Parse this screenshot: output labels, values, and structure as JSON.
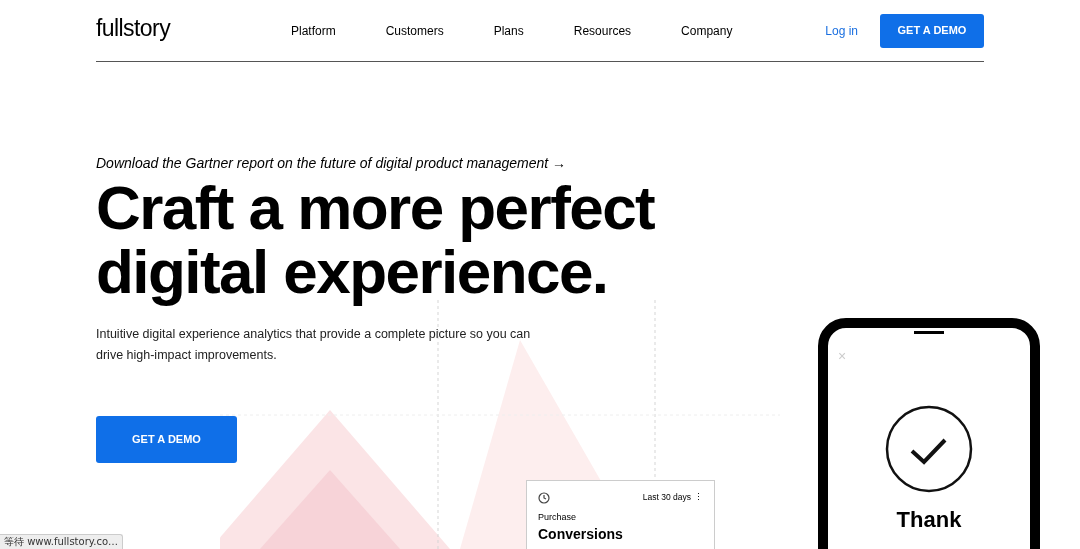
{
  "nav": {
    "logo": "fullstory",
    "links": [
      "Platform",
      "Customers",
      "Plans",
      "Resources",
      "Company"
    ],
    "login": "Log in",
    "cta": "GET A DEMO"
  },
  "hero": {
    "announcement": "Download the Gartner report on the future of digital product management →",
    "title_lines": [
      "Craft a more perfect",
      "digital experience."
    ],
    "subtitle": "Intuitive digital experience analytics that provide a complete picture so you can drive high-impact improvements.",
    "cta": "GET A DEMO"
  },
  "metric_card": {
    "range": "Last 30 days",
    "menu": "⋮",
    "label": "Purchase",
    "title": "Conversions"
  },
  "phone": {
    "close": "×",
    "message": "Thank"
  },
  "status_bar": {
    "text": "等待 www.fullstory.co…"
  }
}
